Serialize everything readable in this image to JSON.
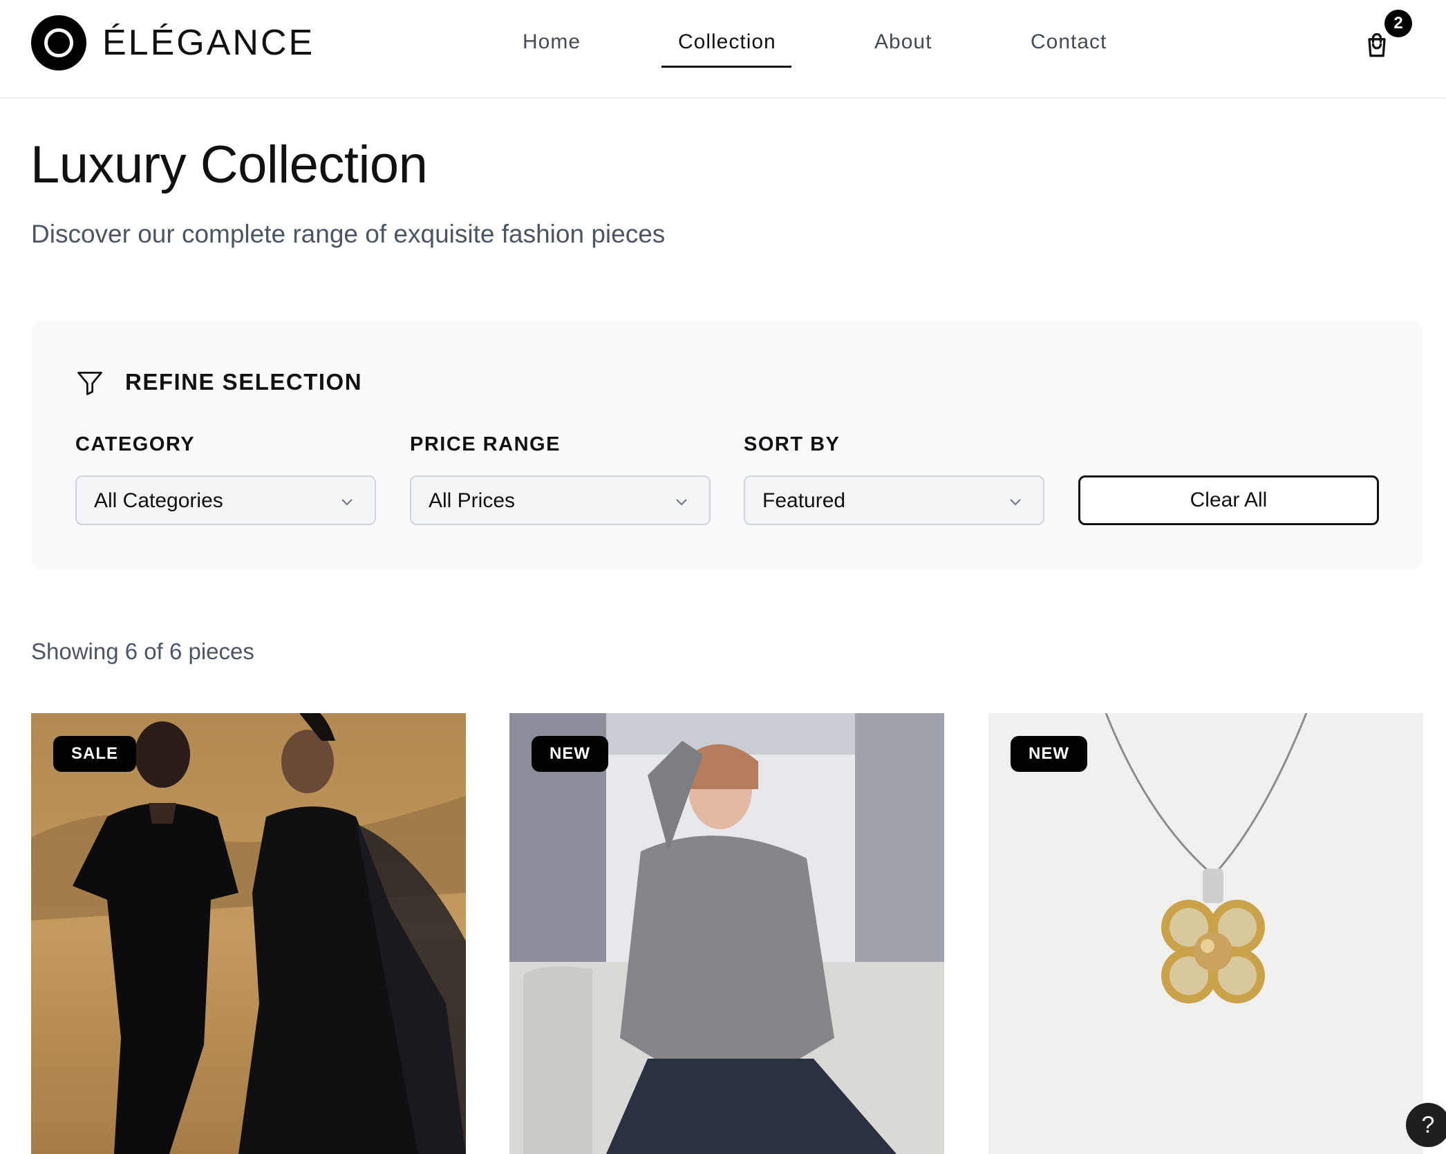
{
  "header": {
    "brand": "ÉLÉGANCE",
    "nav": [
      {
        "label": "Home"
      },
      {
        "label": "Collection",
        "active": true
      },
      {
        "label": "About"
      },
      {
        "label": "Contact"
      }
    ],
    "cart_count": "2"
  },
  "page": {
    "title": "Luxury Collection",
    "subtitle": "Discover our complete range of exquisite fashion pieces"
  },
  "filters": {
    "heading": "REFINE SELECTION",
    "category": {
      "label": "CATEGORY",
      "value": "All Categories"
    },
    "price": {
      "label": "PRICE RANGE",
      "value": "All Prices"
    },
    "sort": {
      "label": "SORT BY",
      "value": "Featured"
    },
    "clear_label": "Clear All"
  },
  "results": {
    "count_text": "Showing 6 of 6 pieces"
  },
  "products": [
    {
      "badge": "SALE",
      "image": "two models in black gowns in desert"
    },
    {
      "badge": "NEW",
      "image": "model in grey hoodie on sofa"
    },
    {
      "badge": "NEW",
      "image": "gold flower pendant necklace with pearl"
    }
  ],
  "help": {
    "label": "?"
  },
  "colors": {
    "accent": "#111111",
    "muted": "#4b5563",
    "panel": "#f8f9fb"
  }
}
